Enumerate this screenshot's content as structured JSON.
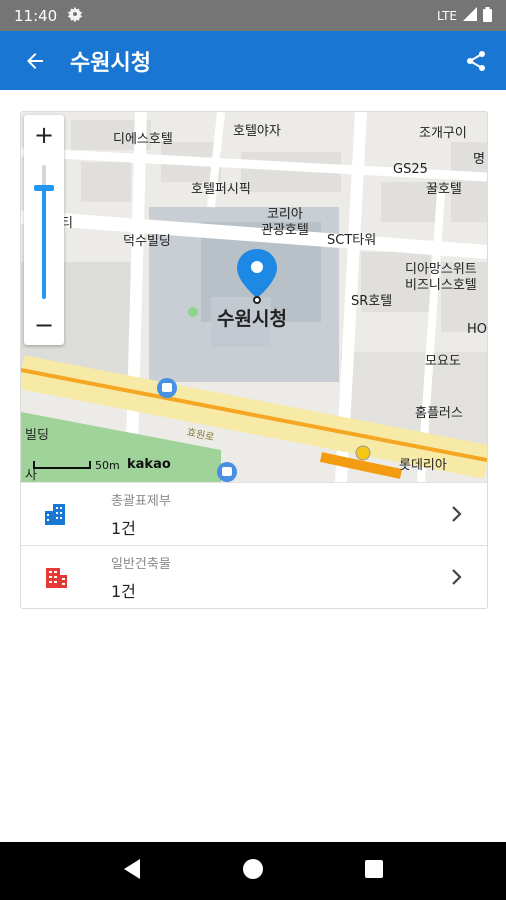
{
  "status_bar": {
    "time": "11:40",
    "network": "LTE"
  },
  "app_bar": {
    "title": "수원시청"
  },
  "map": {
    "labels": {
      "dies_hotel": "디에스호텔",
      "hotel_yaja": "호텔야자",
      "jogae_gui": "조개구이",
      "gs25": "GS25",
      "kkul_hotel": "꿀호텔",
      "hotel_pacific": "호텔퍼시픽",
      "korea_hotel": "코리아\n관광호텔",
      "sct_tower": "SCT타워",
      "deoksu_building": "덕수빌딩",
      "diamond_suite": "디아망스위트\n비즈니스호텔",
      "sr_hotel": "SR호텔",
      "city_hall": "수원시청",
      "moyodo": "모요도",
      "homeplus": "홈플러스",
      "road_name": "효원로",
      "lotteria": "롯데리아",
      "building_left": "빌딩",
      "city_left": "시티",
      "myeong": "명",
      "ho": "HO",
      "sa": "사"
    },
    "scale_label": "50m",
    "logo": "kakao",
    "zoom_in": "+",
    "zoom_out": "−"
  },
  "rows": [
    {
      "label": "총괄표제부",
      "count": "1건",
      "icon": "building-icon",
      "color": "#1976d2"
    },
    {
      "label": "일반건축물",
      "count": "1건",
      "icon": "building-icon",
      "color": "#e53935"
    }
  ]
}
